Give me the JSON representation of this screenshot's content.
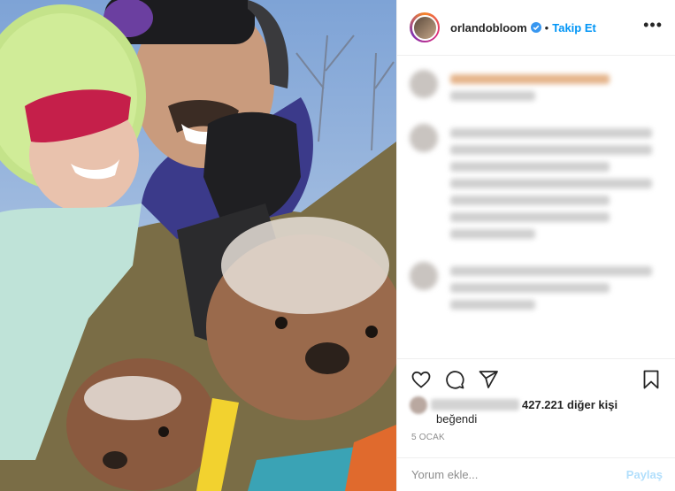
{
  "header": {
    "username": "orlandobloom",
    "separator": "•",
    "follow_label": "Takip Et",
    "more_label": "•••"
  },
  "icons": {
    "like": "heart-outline-icon",
    "comment": "comment-bubble-icon",
    "share": "paper-plane-icon",
    "save": "bookmark-icon",
    "verified": "verified-badge-icon"
  },
  "likes": {
    "count_text": "427.221",
    "others_text": "diğer kişi",
    "liked_text": "beğendi"
  },
  "date": "5 OCAK",
  "add_comment": {
    "placeholder": "Yorum ekle...",
    "post_label": "Paylaş"
  },
  "colors": {
    "link": "#0095f6",
    "verified": "#3897f0",
    "post_disabled": "#b2dffc"
  }
}
